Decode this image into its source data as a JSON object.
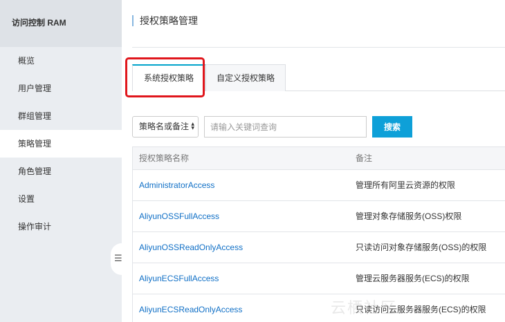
{
  "sidebar": {
    "title": "访问控制 RAM",
    "items": [
      {
        "label": "概览",
        "active": false
      },
      {
        "label": "用户管理",
        "active": false
      },
      {
        "label": "群组管理",
        "active": false
      },
      {
        "label": "策略管理",
        "active": true
      },
      {
        "label": "角色管理",
        "active": false
      },
      {
        "label": "设置",
        "active": false
      },
      {
        "label": "操作审计",
        "active": false
      }
    ],
    "collapse_icon": "menu-collapse-icon"
  },
  "main": {
    "title": "授权策略管理",
    "tabs": [
      {
        "label": "系统授权策略",
        "active": true
      },
      {
        "label": "自定义授权策略",
        "active": false
      }
    ],
    "filter": {
      "selected": "策略名或备注",
      "placeholder": "请输入关键词查询",
      "value": "",
      "search_label": "搜索"
    },
    "table": {
      "headers": [
        "授权策略名称",
        "备注"
      ],
      "rows": [
        {
          "name": "AdministratorAccess",
          "note": "管理所有阿里云资源的权限"
        },
        {
          "name": "AliyunOSSFullAccess",
          "note": "管理对象存储服务(OSS)权限"
        },
        {
          "name": "AliyunOSSReadOnlyAccess",
          "note": "只读访问对象存储服务(OSS)的权限"
        },
        {
          "name": "AliyunECSFullAccess",
          "note": "管理云服务器服务(ECS)的权限"
        },
        {
          "name": "AliyunECSReadOnlyAccess",
          "note": "只读访问云服务器服务(ECS)的权限"
        }
      ]
    }
  },
  "colors": {
    "accent": "#0ea0d8",
    "link": "#0f6fc6",
    "highlight": "#e0161c",
    "sidebar_bg": "#eaedf1"
  },
  "watermark": "云栖社区"
}
